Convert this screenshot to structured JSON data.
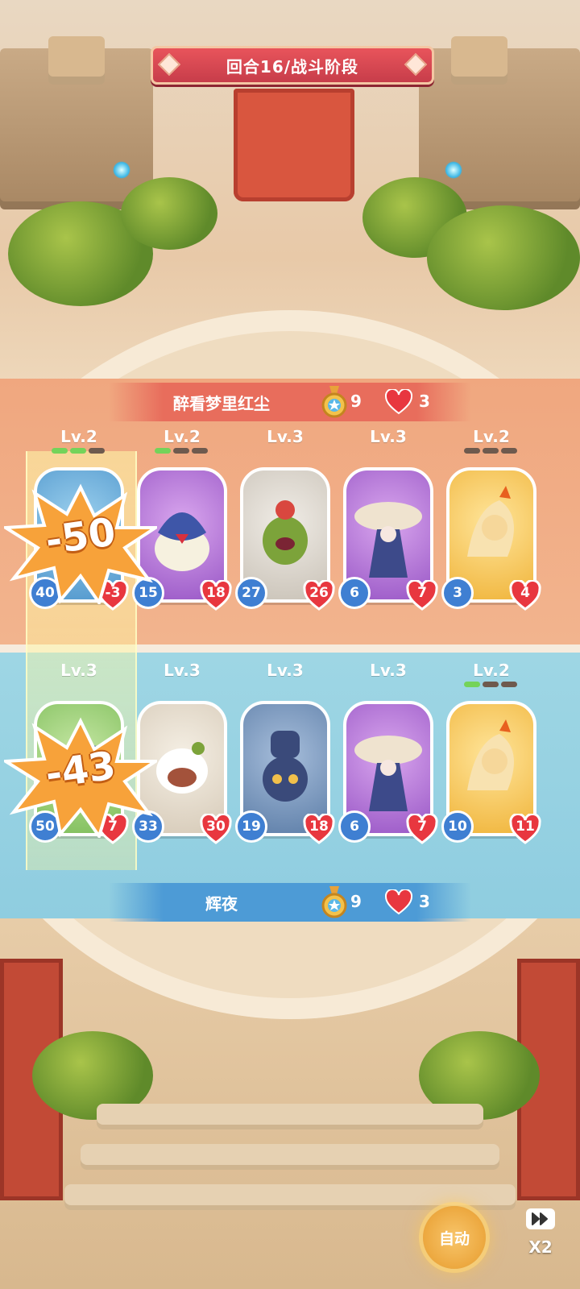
{
  "header": {
    "round_label": "回合16/战斗阶段"
  },
  "opponent": {
    "name": "醉看梦里红尘",
    "medal_count": "9",
    "lives": "3",
    "units": [
      {
        "level": "Lv.2",
        "stars_on": 2,
        "attack": "40",
        "hp": "-3",
        "color": "blue",
        "monster": "raccoon-creature-icon"
      },
      {
        "level": "Lv.2",
        "stars_on": 1,
        "attack": "15",
        "hp": "18",
        "color": "purple",
        "monster": "blue-bird-creature-icon"
      },
      {
        "level": "Lv.3",
        "stars_on": 0,
        "attack": "27",
        "hp": "26",
        "color": "grey",
        "monster": "green-plant-creature-icon"
      },
      {
        "level": "Lv.3",
        "stars_on": 0,
        "attack": "6",
        "hp": "7",
        "color": "purple",
        "monster": "mushroom-lady-creature-icon"
      },
      {
        "level": "Lv.2",
        "stars_on": 0,
        "attack": "3",
        "hp": "4",
        "color": "gold",
        "monster": "fire-dragon-creature-icon"
      }
    ]
  },
  "player": {
    "name": "辉夜",
    "medal_count": "9",
    "lives": "3",
    "units": [
      {
        "level": "Lv.3",
        "stars_on": 0,
        "attack": "50",
        "hp": "7",
        "color": "green",
        "monster": "blue-blob-creature-icon"
      },
      {
        "level": "Lv.3",
        "stars_on": 0,
        "attack": "33",
        "hp": "30",
        "color": "cream",
        "monster": "fluffy-sheep-creature-icon"
      },
      {
        "level": "Lv.3",
        "stars_on": 0,
        "attack": "19",
        "hp": "18",
        "color": "navy",
        "monster": "fist-creature-icon"
      },
      {
        "level": "Lv.3",
        "stars_on": 0,
        "attack": "6",
        "hp": "7",
        "color": "purple",
        "monster": "mushroom-lady-creature-icon"
      },
      {
        "level": "Lv.2",
        "stars_on": 1,
        "attack": "10",
        "hp": "11",
        "color": "gold",
        "monster": "fire-dragon-creature-icon"
      }
    ]
  },
  "damage": {
    "opponent_hit": "-50",
    "player_hit": "-43"
  },
  "controls": {
    "auto_label": "自动",
    "speed_label": "X2"
  },
  "colors": {
    "attack_badge": "#3f7fd2",
    "hp_heart": "#e8373f",
    "accent": "#e8545b"
  }
}
